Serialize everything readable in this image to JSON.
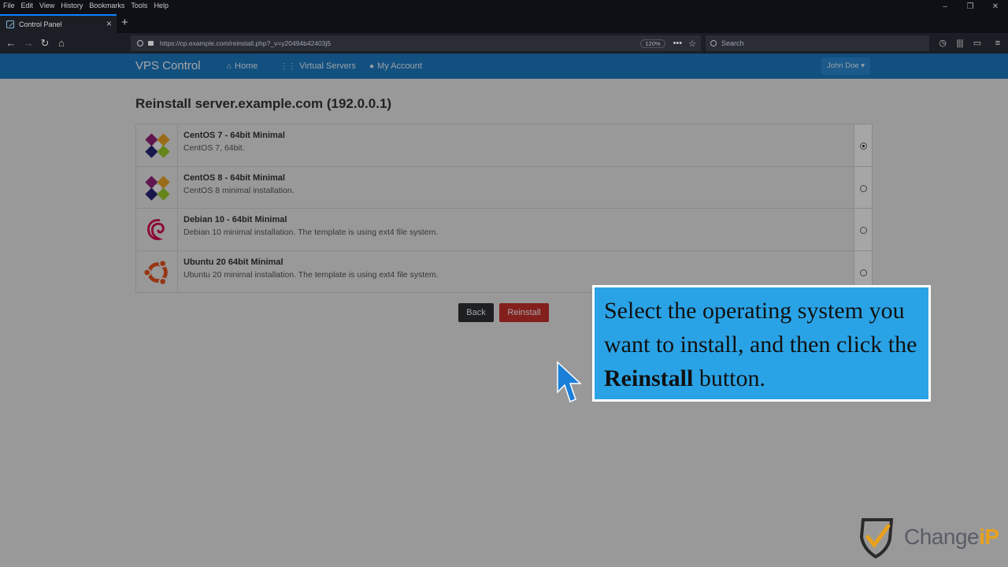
{
  "browser": {
    "menu": [
      "File",
      "Edit",
      "View",
      "History",
      "Bookmarks",
      "Tools",
      "Help"
    ],
    "tab_title": "Control Panel",
    "url": "https://cp.example.com/reinstall.php?_v=y20494b42403j5",
    "zoom": "120%",
    "search_placeholder": "Search"
  },
  "site": {
    "brand": "VPS Control",
    "nav": {
      "home": "Home",
      "virtual_servers": "Virtual Servers",
      "my_account": "My Account"
    },
    "user_menu": "John Doe ▾"
  },
  "main": {
    "title": "Reinstall server.example.com (192.0.0.1)",
    "os_options": [
      {
        "name": "CentOS 7 - 64bit Minimal",
        "description": "CentOS 7, 64bit.",
        "icon": "centos-icon",
        "selected": true
      },
      {
        "name": "CentOS 8 - 64bit Minimal",
        "description": "CentOS 8 minimal installation.",
        "icon": "centos-icon",
        "selected": false
      },
      {
        "name": "Debian 10 - 64bit Minimal",
        "description": "Debian 10 minimal installation. The template is using ext4 file system.",
        "icon": "debian-icon",
        "selected": false
      },
      {
        "name": "Ubuntu 20 64bit Minimal",
        "description": "Ubuntu 20 minimal installation. The template is using ext4 file system.",
        "icon": "ubuntu-icon",
        "selected": false
      }
    ],
    "back_label": "Back",
    "reinstall_label": "Reinstall"
  },
  "callout": {
    "text_before": "Select the operating system you want to install, and then click the ",
    "bold": "Reinstall",
    "text_after": " button."
  },
  "watermark": {
    "text": "Change",
    "suffix": "iP"
  }
}
